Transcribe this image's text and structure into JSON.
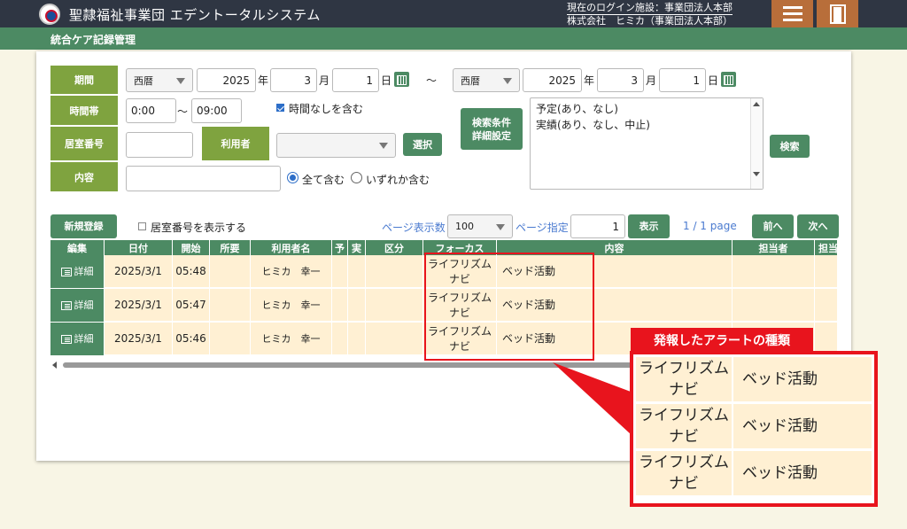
{
  "header": {
    "app_title": "聖隷福祉事業団 エデントータルシステム",
    "login_facility": "現在のログイン施設：事業団法人本部",
    "login_user": "株式会社　ヒミカ（事業団法人本部）",
    "menu_icon": "hamburger-icon",
    "logout_icon": "door-icon"
  },
  "subheader": {
    "title": "統合ケア記録管理"
  },
  "search": {
    "period_label": "期間",
    "era_from": "西暦",
    "year_from": "2025",
    "year_unit": "年",
    "month_from": "3",
    "month_unit": "月",
    "day_from": "1",
    "day_unit": "日",
    "tilde": "～",
    "era_to": "西暦",
    "year_to": "2025",
    "month_to": "3",
    "day_to": "1",
    "timeslot_label": "時間帯",
    "time_from": "0:00",
    "time_tilde": "～",
    "time_to": "09:00",
    "include_no_time": "時間なしを含む",
    "room_label": "居室番号",
    "room_value": "",
    "user_label": "利用者",
    "user_value": "",
    "select_button": "選択",
    "content_label": "内容",
    "content_value": "",
    "radio_all": "全て含む",
    "radio_any": "いずれか含む",
    "advanced_button_line1": "検索条件",
    "advanced_button_line2": "詳細設定",
    "conditions_line1": "予定(あり、なし)",
    "conditions_line2": "実績(あり、なし、中止)",
    "search_button": "検索"
  },
  "toolbar": {
    "new_button": "新規登録",
    "show_room": "居室番号を表示する",
    "page_size_label": "ページ表示数",
    "page_size": "100",
    "page_specify_label": "ページ指定",
    "page_input": "1",
    "show_button": "表示",
    "page_info": "1 / 1 page",
    "prev_button": "前へ",
    "next_button": "次へ"
  },
  "table": {
    "headers": [
      "編集",
      "日付",
      "開始",
      "所要",
      "利用者名",
      "予",
      "実",
      "区分",
      "フォーカス",
      "内容",
      "担当者",
      "担当"
    ],
    "detail_label": "詳細",
    "rows": [
      {
        "date": "2025/3/1",
        "start": "05:48",
        "user": "ヒミカ　幸一",
        "focus_line1": "ライフリズム",
        "focus_line2": "ナビ",
        "content": "ベッド活動"
      },
      {
        "date": "2025/3/1",
        "start": "05:47",
        "user": "ヒミカ　幸一",
        "focus_line1": "ライフリズム",
        "focus_line2": "ナビ",
        "content": "ベッド活動"
      },
      {
        "date": "2025/3/1",
        "start": "05:46",
        "user": "ヒミカ　幸一",
        "focus_line1": "ライフリズム",
        "focus_line2": "ナビ",
        "content": "ベッド活動"
      }
    ]
  },
  "annotation": {
    "label": "発報したアラートの種類",
    "rows": [
      {
        "focus_line1": "ライフリズム",
        "focus_line2": "ナビ",
        "content": "ベッド活動"
      },
      {
        "focus_line1": "ライフリズム",
        "focus_line2": "ナビ",
        "content": "ベッド活動"
      },
      {
        "focus_line1": "ライフリズム",
        "focus_line2": "ナビ",
        "content": "ベッド活動"
      }
    ],
    "color": "#e8141d"
  },
  "colors": {
    "header_bg": "#2f3643",
    "subheader_bg": "#4c8a63",
    "label_bg": "#7fa33f",
    "row_bg": "#fff0d3",
    "menu_btn_bg": "#b86e3a"
  }
}
